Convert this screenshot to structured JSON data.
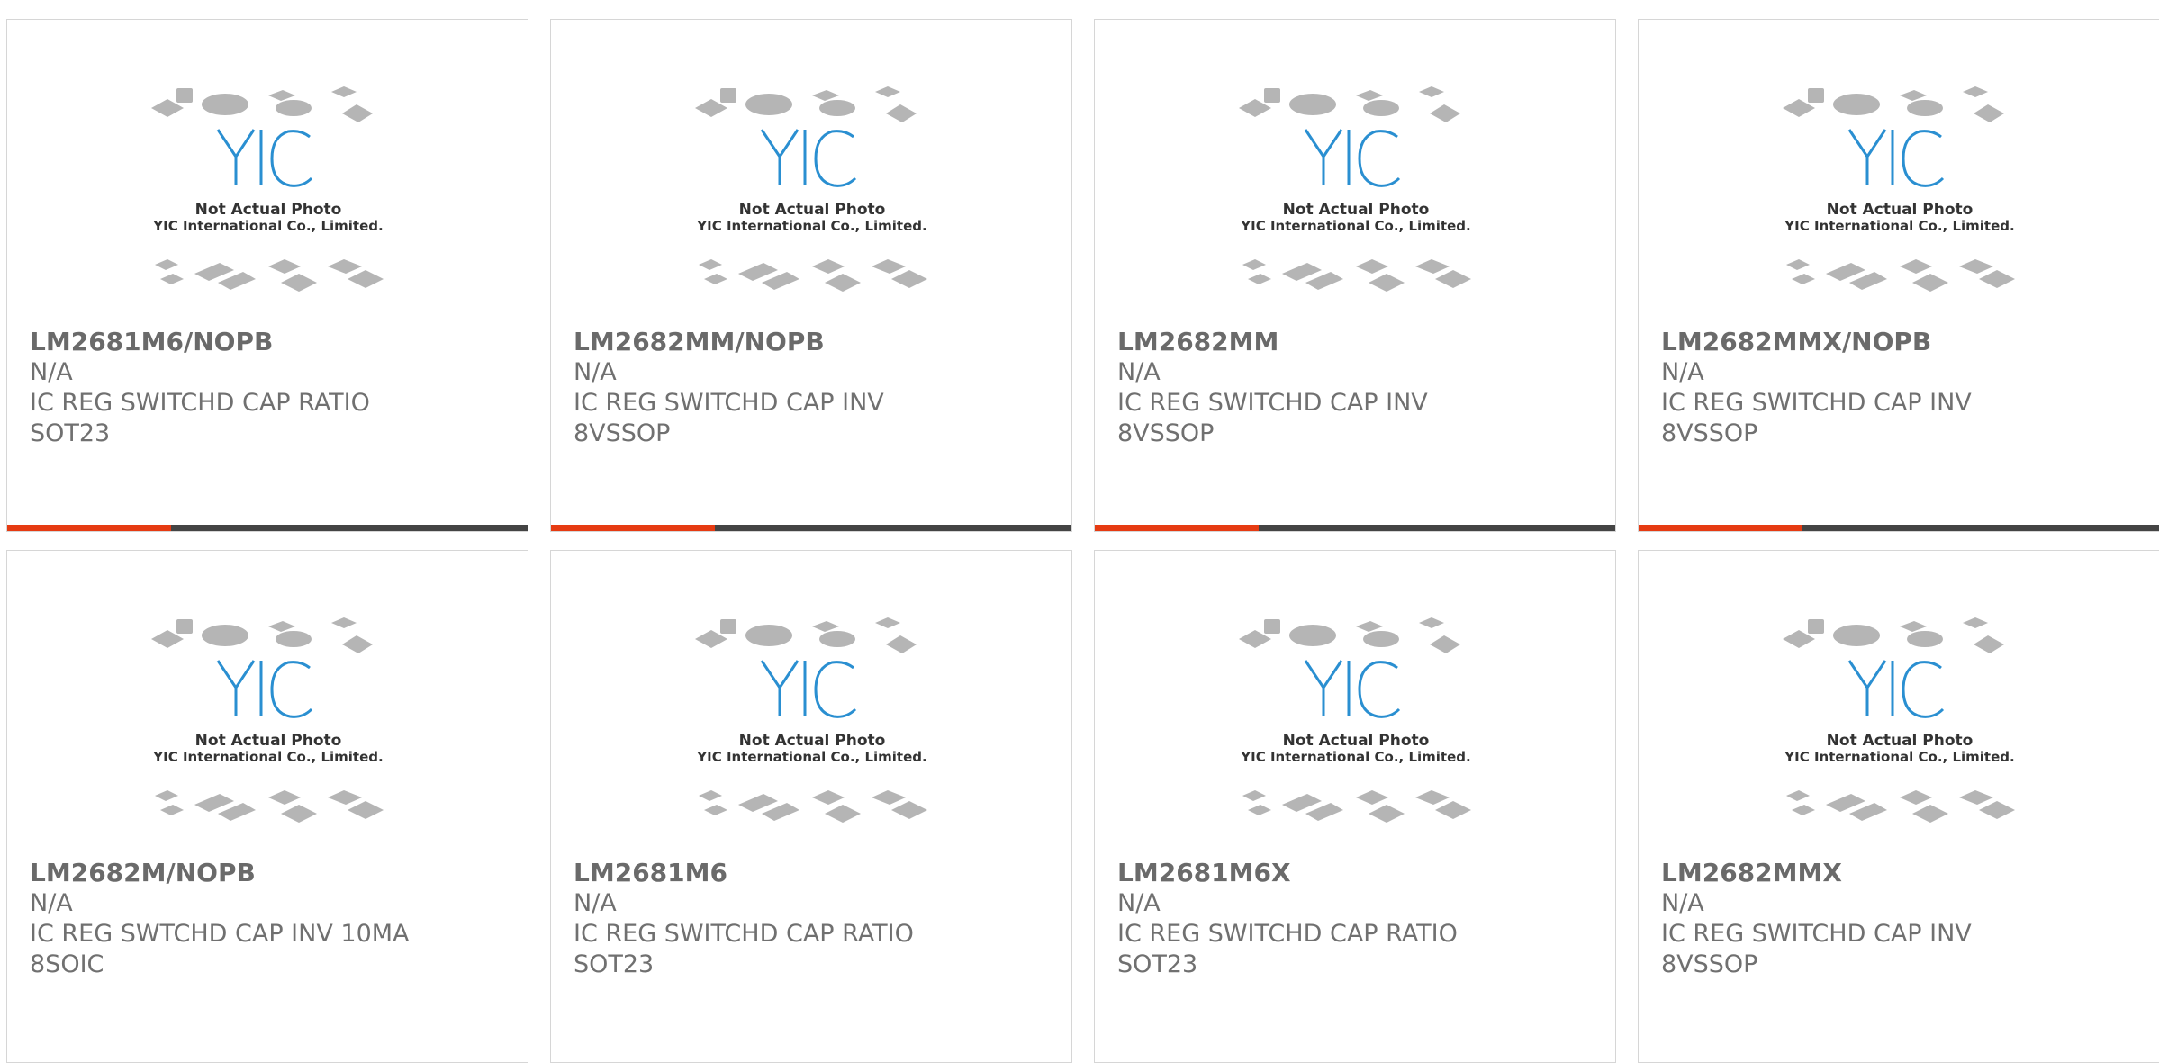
{
  "colors": {
    "accent": "#e63b12",
    "bar_dark": "#444444",
    "logo_blue": "#2a8fd1",
    "text_gray": "#707070",
    "chip_gray": "#b5b5b5"
  },
  "placeholder_image": {
    "icon": "yic-logo-icon",
    "line1": "Not Actual Photo",
    "line2": "YIC International Co., Limited.",
    "logo_text": "YIC"
  },
  "products": [
    {
      "part": "LM2681M6/NOPB",
      "mfr": "N/A",
      "desc1": "IC REG SWITCHD CAP RATIO",
      "desc2": "SOT23",
      "has_bar": true
    },
    {
      "part": "LM2682MM/NOPB",
      "mfr": "N/A",
      "desc1": "IC REG SWITCHD CAP INV",
      "desc2": "8VSSOP",
      "has_bar": true
    },
    {
      "part": "LM2682MM",
      "mfr": "N/A",
      "desc1": "IC REG SWITCHD CAP INV",
      "desc2": "8VSSOP",
      "has_bar": true
    },
    {
      "part": "LM2682MMX/NOPB",
      "mfr": "N/A",
      "desc1": "IC REG SWITCHD CAP INV",
      "desc2": "8VSSOP",
      "has_bar": true
    },
    {
      "part": "LM2682M/NOPB",
      "mfr": "N/A",
      "desc1": "IC REG SWTCHD CAP INV 10MA",
      "desc2": "8SOIC",
      "has_bar": false
    },
    {
      "part": "LM2681M6",
      "mfr": "N/A",
      "desc1": "IC REG SWITCHD CAP RATIO",
      "desc2": "SOT23",
      "has_bar": false
    },
    {
      "part": "LM2681M6X",
      "mfr": "N/A",
      "desc1": "IC REG SWITCHD CAP RATIO",
      "desc2": "SOT23",
      "has_bar": false
    },
    {
      "part": "LM2682MMX",
      "mfr": "N/A",
      "desc1": "IC REG SWITCHD CAP INV",
      "desc2": "8VSSOP",
      "has_bar": false
    }
  ]
}
